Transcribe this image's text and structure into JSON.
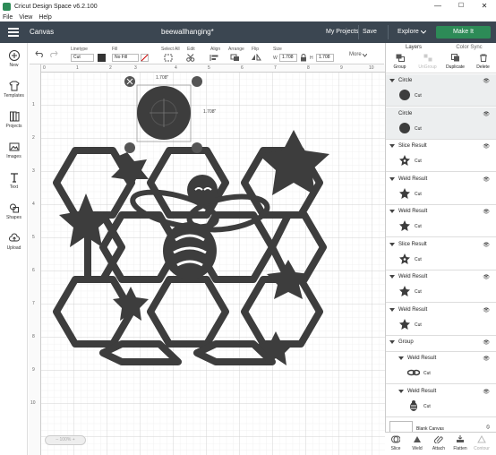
{
  "window": {
    "title": "Cricut Design Space  v6.2.100",
    "min": "—",
    "max": "☐",
    "close": "✕"
  },
  "menu": [
    "File",
    "View",
    "Help"
  ],
  "header": {
    "section": "Canvas",
    "project_name": "beewallhanging*",
    "my_projects": "My Projects",
    "save": "Save",
    "machine": "Explore",
    "make_it": "Make It"
  },
  "toolbar": {
    "linetype_label": "Linetype",
    "linetype_value": "Cut",
    "fill_label": "Fill",
    "fill_value": "No Fill",
    "select_all": "Select All",
    "edit": "Edit",
    "align": "Align",
    "arrange": "Arrange",
    "flip": "Flip",
    "size": "Size",
    "w_label": "W",
    "w_value": "1.708",
    "h_label": "H",
    "h_value": "1.708",
    "more": "More"
  },
  "leftbar": [
    {
      "label": "New",
      "icon": "plus-icon"
    },
    {
      "label": "Templates",
      "icon": "shirt-icon"
    },
    {
      "label": "Projects",
      "icon": "books-icon"
    },
    {
      "label": "Images",
      "icon": "image-icon"
    },
    {
      "label": "Text",
      "icon": "text-icon"
    },
    {
      "label": "Shapes",
      "icon": "shapes-icon"
    },
    {
      "label": "Upload",
      "icon": "upload-icon"
    }
  ],
  "ruler": {
    "top": [
      "0",
      "1",
      "2",
      "3",
      "4",
      "5",
      "6",
      "7",
      "8",
      "9",
      "10",
      "11",
      "12",
      "13"
    ],
    "left": [
      "1",
      "2",
      "3",
      "4",
      "5",
      "6",
      "7",
      "8",
      "9",
      "10",
      "11"
    ]
  },
  "selection": {
    "width_label": "1.708\"",
    "height_label": "1.708\""
  },
  "zoom": "100%",
  "layers_panel": {
    "tabs": [
      "Layers",
      "Color Sync"
    ],
    "tools": [
      "Group",
      "UnGroup",
      "Duplicate",
      "Delete"
    ],
    "rows": [
      {
        "name": "Circle",
        "op": "Cut",
        "thumb": "circle",
        "selected": true
      },
      {
        "name": "Circle",
        "op": "Cut",
        "thumb": "circle",
        "selected": true
      },
      {
        "name": "Slice Result",
        "op": "Cut",
        "thumb": "star-outline",
        "selected": false
      },
      {
        "name": "Weld Result",
        "op": "Cut",
        "thumb": "star",
        "selected": false
      },
      {
        "name": "Weld Result",
        "op": "Cut",
        "thumb": "star",
        "selected": false
      },
      {
        "name": "Slice Result",
        "op": "Cut",
        "thumb": "star-outline",
        "selected": false
      },
      {
        "name": "Weld Result",
        "op": "Cut",
        "thumb": "star",
        "selected": false
      },
      {
        "name": "Weld Result",
        "op": "Cut",
        "thumb": "star",
        "selected": false
      },
      {
        "name": "Group",
        "op": "",
        "thumb": "",
        "selected": false
      },
      {
        "name": "Weld Result",
        "op": "Cut",
        "thumb": "bee-wings",
        "selected": false
      },
      {
        "name": "Weld Result",
        "op": "Cut",
        "thumb": "bee-body",
        "selected": false
      }
    ],
    "blank_canvas": "Blank Canvas"
  },
  "bottom_tools": [
    "Slice",
    "Weld",
    "Attach",
    "Flatten",
    "Contour"
  ]
}
